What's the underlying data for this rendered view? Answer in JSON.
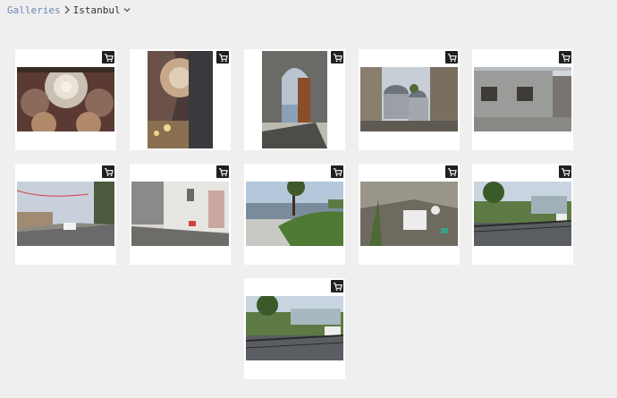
{
  "breadcrumb": {
    "root_label": "Galleries",
    "current_label": "Istanbul",
    "link_color": "#6b87b8"
  },
  "icons": {
    "separator": "chevron-right-icon",
    "dropdown": "chevron-down-icon",
    "cart": "shopping-cart-icon"
  },
  "gallery": {
    "photos": [
      {
        "subject": "mosque-dome-interior"
      },
      {
        "subject": "mosque-interior-column"
      },
      {
        "subject": "arched-doorway"
      },
      {
        "subject": "mosque-domes-street"
      },
      {
        "subject": "building-corner"
      },
      {
        "subject": "street-with-flags"
      },
      {
        "subject": "white-house-street"
      },
      {
        "subject": "waterfront-park"
      },
      {
        "subject": "rooftop-debris"
      },
      {
        "subject": "park-railing"
      },
      {
        "subject": "park-railing-2"
      }
    ]
  }
}
